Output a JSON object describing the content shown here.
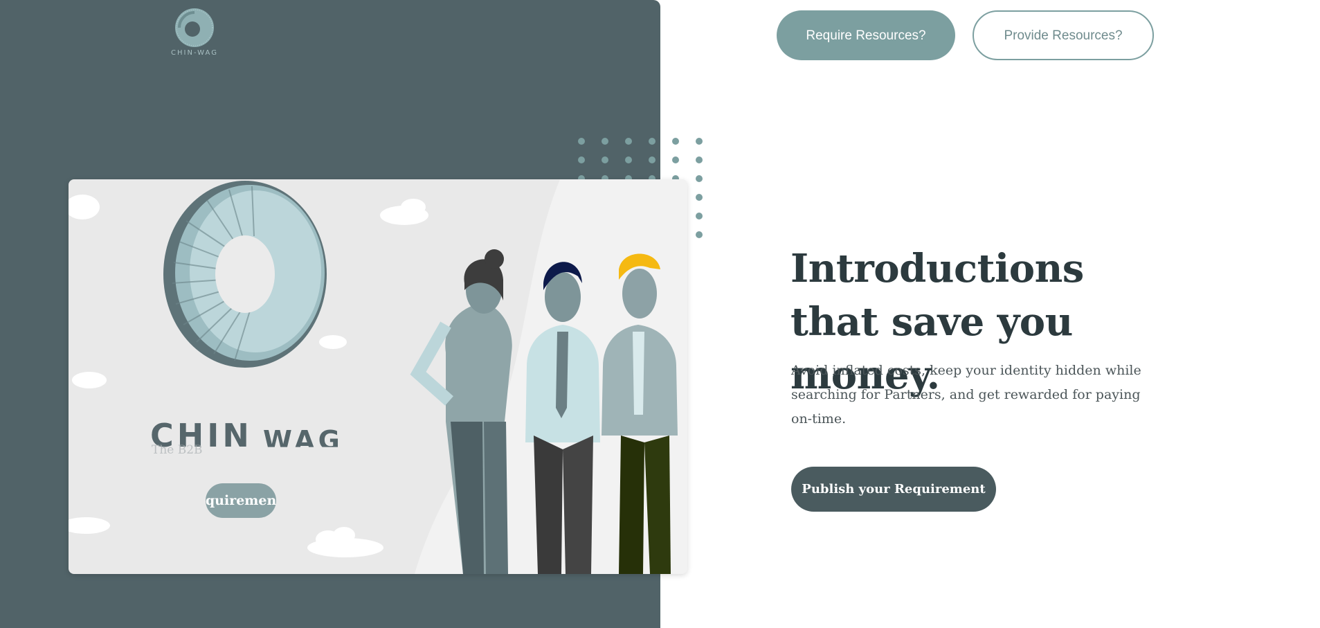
{
  "brand": {
    "logo_text": "CHIN-WAG",
    "card_word_1": "CHIN",
    "card_word_2": "WAG",
    "card_tagline": "The B2B",
    "card_button": "Requirement"
  },
  "header": {
    "require_label": "Require Resources?",
    "provide_label": "Provide Resources?"
  },
  "hero": {
    "headline": "Introductions that save you money.",
    "description": "Avoid inflated costs, keep your identity hidden while searching for Partners, and get rewarded for paying on-time.",
    "cta_label": "Publish your Requirement"
  },
  "colors": {
    "panel": "#516368",
    "accent": "#7c9fa0",
    "dark_button": "#4a5b5f",
    "headline": "#2c3a3e"
  }
}
